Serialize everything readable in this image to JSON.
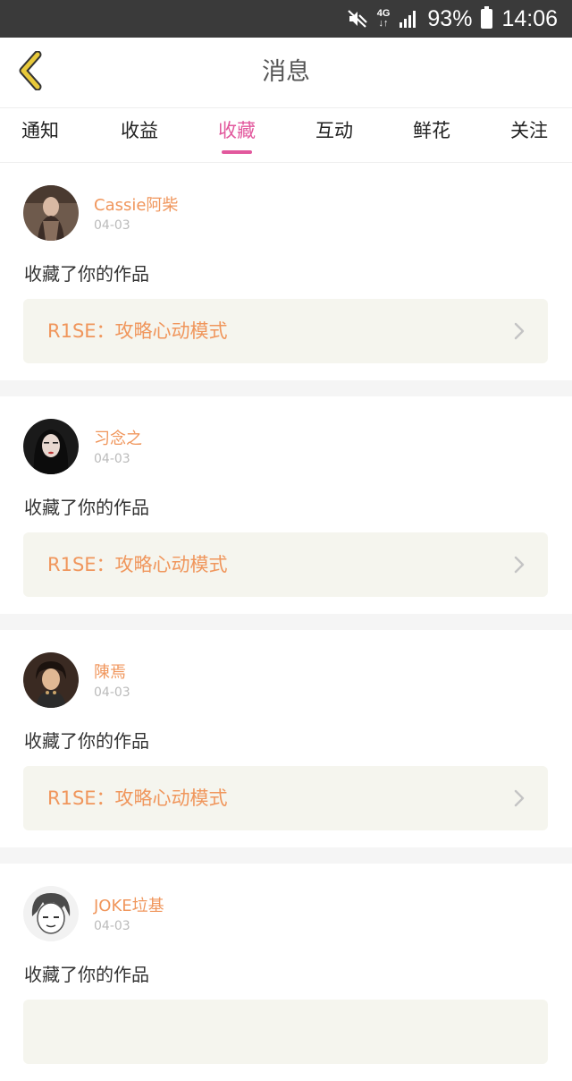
{
  "status_bar": {
    "network_top": "4G",
    "network_bottom": "↓↑",
    "battery": "93%",
    "time": "14:06",
    "icons": [
      "mute-icon",
      "network-4g-icon",
      "signal-icon",
      "battery-icon"
    ]
  },
  "header": {
    "title": "消息",
    "back_icon": "chevron-left-icon",
    "accent_color": "#e8c93a"
  },
  "tabs": [
    {
      "label": "通知",
      "active": false
    },
    {
      "label": "收益",
      "active": false
    },
    {
      "label": "收藏",
      "active": true
    },
    {
      "label": "互动",
      "active": false
    },
    {
      "label": "鲜花",
      "active": false
    },
    {
      "label": "关注",
      "active": false
    }
  ],
  "feed": [
    {
      "username": "Cassie阿柴",
      "date": "04-03",
      "action": "收藏了你的作品",
      "work_title": "R1SE：攻略心动模式"
    },
    {
      "username": "习念之",
      "date": "04-03",
      "action": "收藏了你的作品",
      "work_title": "R1SE：攻略心动模式"
    },
    {
      "username": "陳焉",
      "date": "04-03",
      "action": "收藏了你的作品",
      "work_title": "R1SE：攻略心动模式"
    },
    {
      "username": "JOKE垃基",
      "date": "04-03",
      "action": "收藏了你的作品",
      "work_title": ""
    }
  ],
  "colors": {
    "tab_active": "#e2589d",
    "username": "#f0965c",
    "work_title": "#f0965c",
    "work_card_bg": "#f5f5ee"
  }
}
